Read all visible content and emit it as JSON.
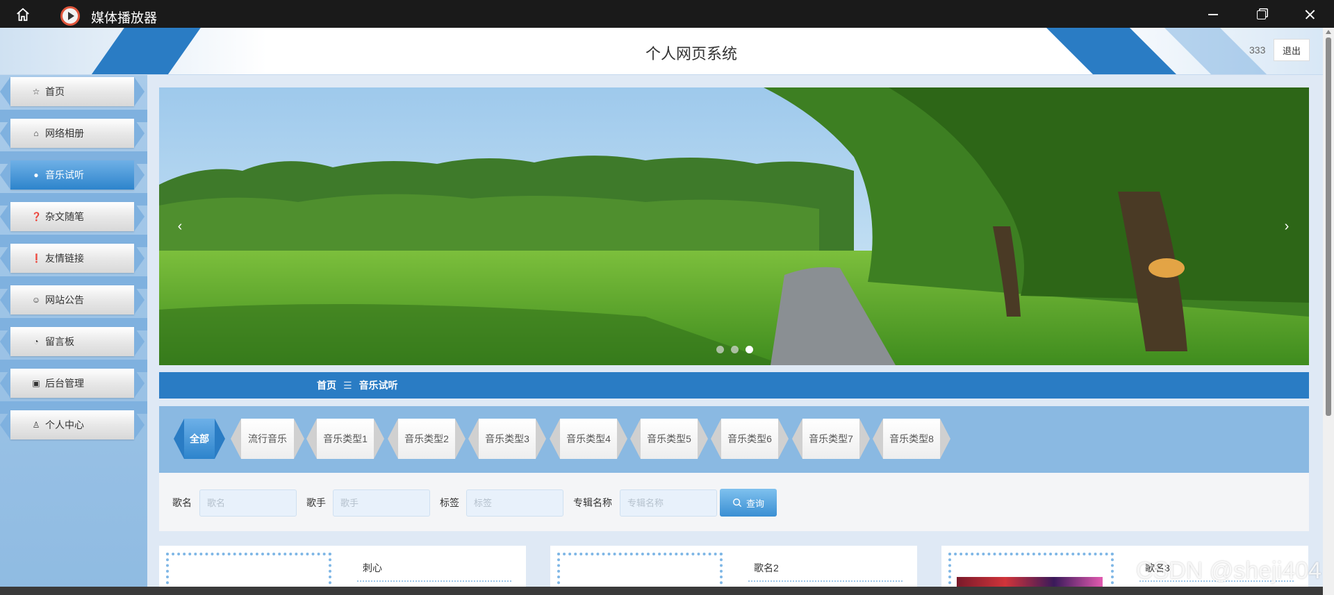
{
  "titlebar": {
    "title": "媒体播放器"
  },
  "header": {
    "site_title": "个人网页系统",
    "username": "333",
    "logout_label": "退出"
  },
  "sidebar": {
    "items": [
      {
        "label": "首页",
        "icon": "star-icon",
        "glyph": "☆",
        "active": false
      },
      {
        "label": "网络相册",
        "icon": "bag-icon",
        "glyph": "⌂",
        "active": false
      },
      {
        "label": "音乐试听",
        "icon": "info-circle-icon",
        "glyph": "●",
        "active": true
      },
      {
        "label": "杂文随笔",
        "icon": "question-circle-icon",
        "glyph": "❓",
        "active": false
      },
      {
        "label": "友情链接",
        "icon": "info-circle-icon",
        "glyph": "❗",
        "active": false
      },
      {
        "label": "网站公告",
        "icon": "smile-icon",
        "glyph": "☺",
        "active": false
      },
      {
        "label": "留言板",
        "icon": "chat-icon",
        "glyph": "◔",
        "active": false
      },
      {
        "label": "后台管理",
        "icon": "briefcase-icon",
        "glyph": "▣",
        "active": false
      },
      {
        "label": "个人中心",
        "icon": "user-icon",
        "glyph": "♙",
        "active": false
      }
    ]
  },
  "banner": {
    "prev": "‹",
    "next": "›",
    "dot_count": 3,
    "active_dot": 2
  },
  "breadcrumb": {
    "home": "首页",
    "separator": "☰",
    "current": "音乐试听"
  },
  "categories": [
    "全部",
    "流行音乐",
    "音乐类型1",
    "音乐类型2",
    "音乐类型3",
    "音乐类型4",
    "音乐类型5",
    "音乐类型6",
    "音乐类型7",
    "音乐类型8"
  ],
  "search": {
    "song_label": "歌名",
    "song_placeholder": "歌名",
    "singer_label": "歌手",
    "singer_placeholder": "歌手",
    "tag_label": "标签",
    "tag_placeholder": "标签",
    "album_label": "专辑名称",
    "album_placeholder": "专辑名称",
    "button_label": "查询"
  },
  "cards": [
    {
      "title": "刺心"
    },
    {
      "title": "歌名2"
    },
    {
      "title": "歌名3"
    }
  ],
  "watermark": "CSDN @sheji404",
  "colors": {
    "accent": "#2a7cc4",
    "sidebar_bg": "#8fbbe2",
    "titlebar": "#1a1a1a"
  }
}
